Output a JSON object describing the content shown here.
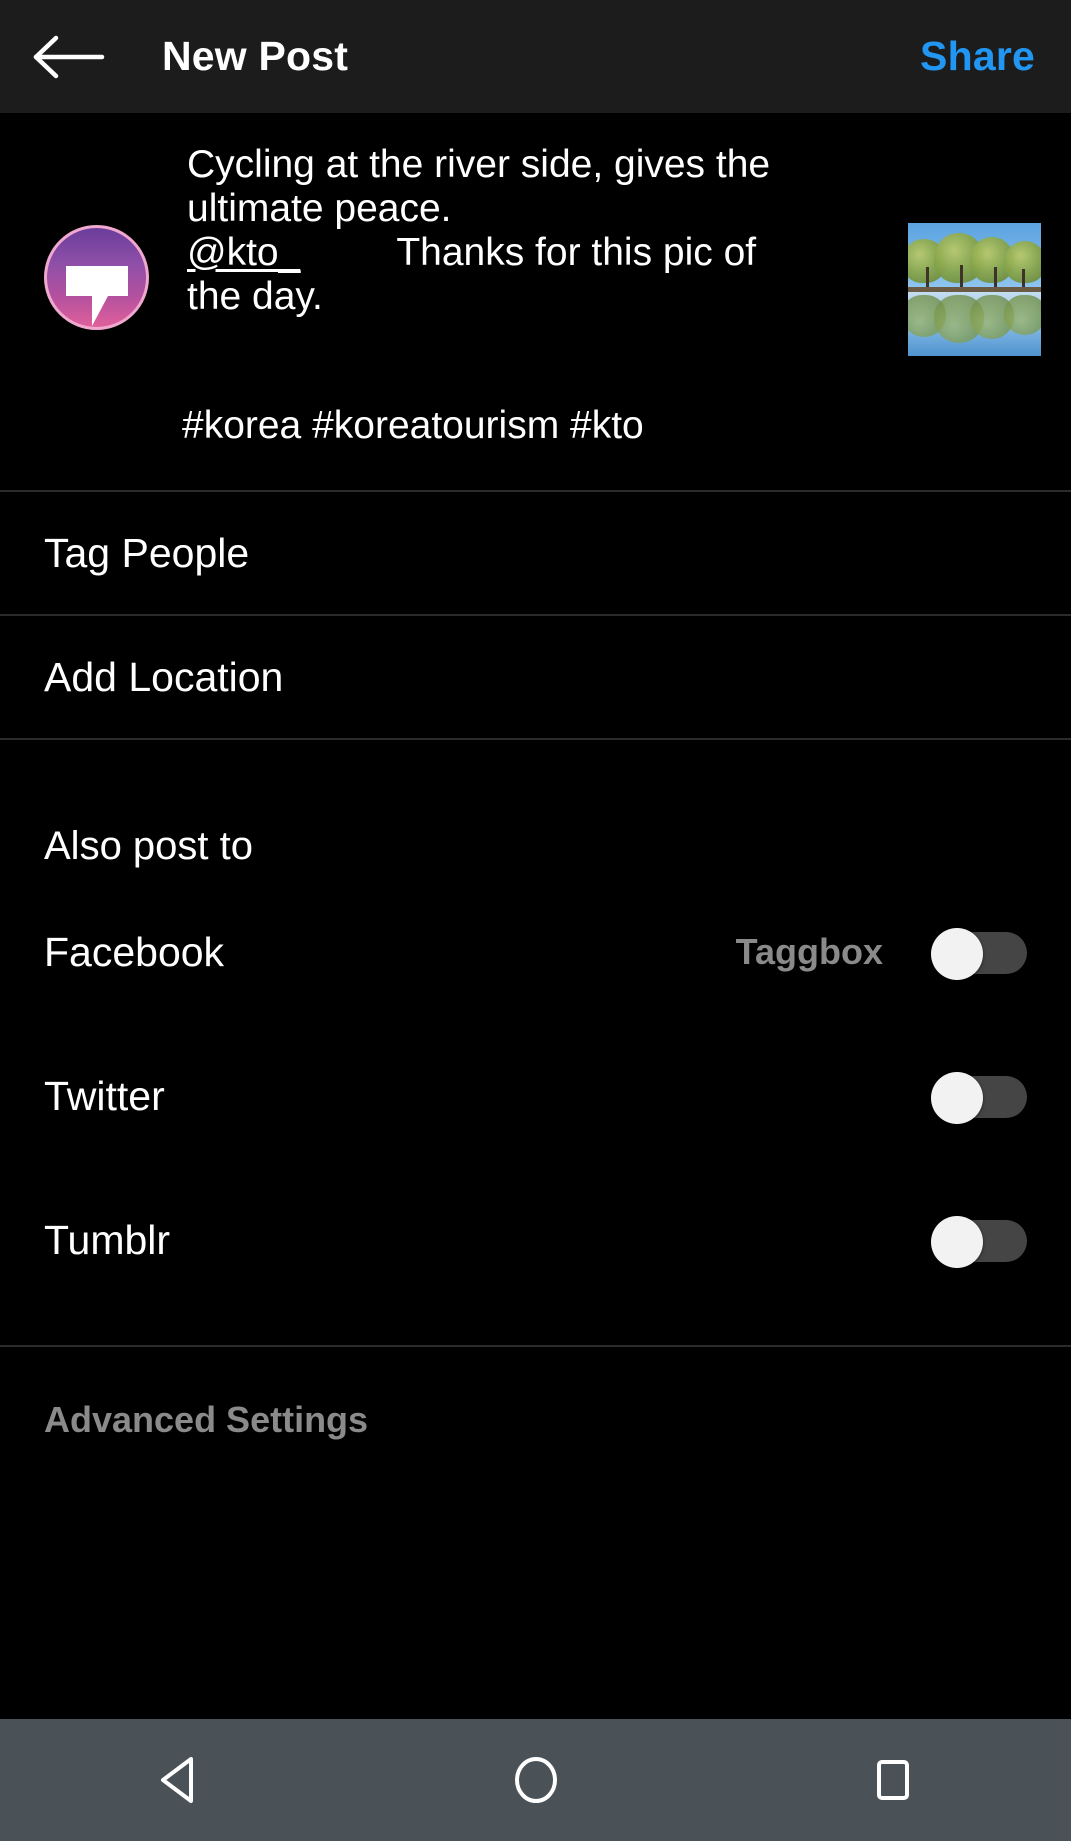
{
  "header": {
    "back_icon": "back-arrow-icon",
    "title": "New Post",
    "share_label": "Share",
    "share_color": "#2196F3"
  },
  "composer": {
    "avatar_icon": "speech-bubble-avatar",
    "caption_line1": "Cycling at the river side, gives the",
    "caption_line2": "ultimate peace.",
    "mention": "@kto_",
    "caption_line3": "Thanks for this pic of",
    "caption_line4": "the day.",
    "hashtags": "#korea #koreatourism #kto",
    "thumbnail_alt": "trees-reflected-in-river-thumbnail"
  },
  "rows": [
    {
      "label": "Tag People",
      "name": "tag-people-row"
    },
    {
      "label": "Add Location",
      "name": "add-location-row"
    }
  ],
  "also_post_to": {
    "heading": "Also post to",
    "services": [
      {
        "name": "Facebook",
        "sub_label": "Taggbox",
        "enabled": false
      },
      {
        "name": "Twitter",
        "sub_label": "",
        "enabled": false
      },
      {
        "name": "Tumblr",
        "sub_label": "",
        "enabled": false
      }
    ]
  },
  "advanced": {
    "label": "Advanced Settings"
  },
  "system_nav": {
    "back_icon": "triangle-back-icon",
    "home_icon": "circle-home-icon",
    "recents_icon": "square-recents-icon",
    "bar_color": "#4a5258"
  }
}
